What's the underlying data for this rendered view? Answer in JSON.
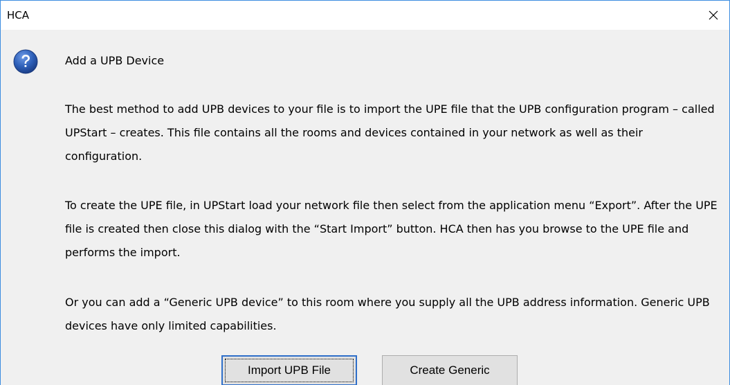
{
  "window": {
    "title": "HCA"
  },
  "dialog": {
    "heading": "Add a UPB Device",
    "paragraphs": [
      "The best method to add UPB devices to your file is to import the UPE file that the UPB configuration program – called UPStart – creates. This file contains all the rooms and devices contained in your network as well as their configuration.",
      "To create the UPE file, in UPStart load your network file then select from the application menu “Export”. After the UPE file is created then close this dialog with the “Start Import” button. HCA then has you browse to the UPE file and performs the import.",
      "Or you can add a “Generic UPB device” to this room where you supply all the UPB address information. Generic UPB devices have only limited capabilities."
    ]
  },
  "buttons": {
    "import_label": "Import UPB File",
    "generic_label": "Create Generic"
  },
  "icons": {
    "close": "close-icon",
    "help": "question-icon"
  },
  "colors": {
    "accent": "#3c8de0",
    "help_icon": "#2a5db0"
  }
}
